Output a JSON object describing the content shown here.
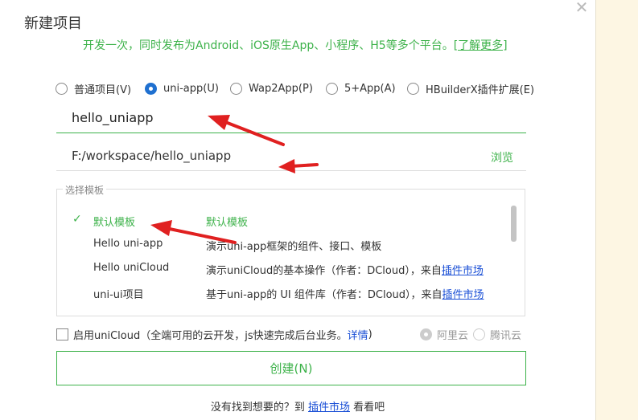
{
  "dialog": {
    "title": "新建项目",
    "subtitle": "开发一次，同时发布为Android、iOS原生App、小程序、H5等多个平台。",
    "learn_more": "[了解更多]"
  },
  "project_types": [
    {
      "label": "普通项目(V)",
      "selected": false
    },
    {
      "label": "uni-app(U)",
      "selected": true
    },
    {
      "label": "Wap2App(P)",
      "selected": false
    },
    {
      "label": "5+App(A)",
      "selected": false
    },
    {
      "label": "HBuilderX插件扩展(E)",
      "selected": false
    }
  ],
  "project_name": {
    "value": "hello_uniapp"
  },
  "project_path": {
    "value": "F:/workspace/hello_uniapp",
    "browse_label": "浏览"
  },
  "templates": {
    "legend": "选择模板",
    "items": [
      {
        "name": "默认模板",
        "desc": "默认模板",
        "selected": true
      },
      {
        "name": "Hello uni-app",
        "desc": "演示uni-app框架的组件、接口、模板"
      },
      {
        "name": "Hello uniCloud",
        "desc": "演示uniCloud的基本操作（作者：DCloud），来自",
        "link": "插件市场"
      },
      {
        "name": "uni-ui项目",
        "desc": "基于uni-app的 UI 组件库（作者：DCloud），来自",
        "link": "插件市场"
      }
    ]
  },
  "unicloud": {
    "label": "启用uniCloud（全端可用的云开发，js快速完成后台业务。",
    "link": "详情",
    "suffix": ")",
    "providers": [
      {
        "label": "阿里云",
        "selected": true
      },
      {
        "label": "腾讯云",
        "selected": false
      }
    ]
  },
  "create_button": "创建(N)",
  "footer": {
    "prefix": "没有找到想要的？到",
    "link": "插件市场",
    "suffix": "看看吧"
  },
  "colors": {
    "accent": "#3db24a",
    "link": "#1a4fd6",
    "radio": "#1f70d0",
    "arrow": "#e02020"
  }
}
